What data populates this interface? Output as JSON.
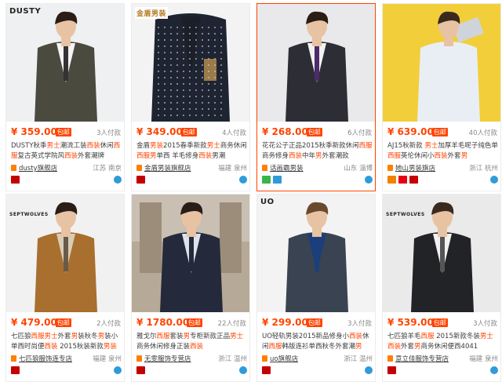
{
  "products": [
    {
      "brand": "DUSTY",
      "brand_style": "text",
      "price": "¥ 359.00",
      "tag": "包邮",
      "buyers": "3人付款",
      "title_parts": [
        "DUSTY秋季",
        "男士",
        "潮流工装",
        "西装",
        "休闲",
        "西服",
        "复古英式学院风",
        "西装",
        "外套潮牌"
      ],
      "title_hl": [
        false,
        true,
        false,
        true,
        false,
        true,
        false,
        true,
        false
      ],
      "shop": "dusty旗舰店",
      "location": "江苏 南京",
      "badges": [
        "tmall-icon"
      ],
      "colors": {
        "bg": "#eef0f2",
        "coat": "#4a4a3f",
        "shirt": "#f4f4f4",
        "pants": "#2b2b2b",
        "tie": "#333333",
        "skin": "#e7c3a3",
        "hair": "#2a1d17"
      }
    },
    {
      "brand": "金盾男装",
      "brand_style": "logo",
      "price": "¥ 349.00",
      "tag": "包邮",
      "buyers": "4人付款",
      "title_parts": [
        "金盾",
        "男装",
        "2015春季新款",
        "男士",
        "商务休闲",
        "西服",
        "男",
        "单西 羊毛修身",
        "西装",
        "男潮"
      ],
      "title_hl": [
        false,
        true,
        false,
        true,
        false,
        true,
        true,
        false,
        true,
        false
      ],
      "shop": "金盾男装旗舰店",
      "location": "福建 泉州",
      "badges": [
        "tmall-icon"
      ],
      "colors": {
        "bg": "#f3f3f3",
        "coat": "#1e2431",
        "shirt": "#1b1f28",
        "pants": "#1e2431",
        "tie": "#1e2431",
        "skin": "#ffffff",
        "hair": "#ffffff"
      }
    },
    {
      "brand": "",
      "brand_style": "none",
      "price": "¥ 268.00",
      "tag": "包邮",
      "buyers": "6人付款",
      "title_parts": [
        "花花公子正品2015秋季新款休闲",
        "西服",
        " 商务修身",
        "西装",
        "中年",
        "男",
        "外套潮款"
      ],
      "title_hl": [
        false,
        true,
        false,
        true,
        false,
        true,
        false
      ],
      "shop": "话画霸男装",
      "location": "山东 淄博",
      "badges": [
        "green-badge",
        "blue-badge"
      ],
      "colors": {
        "bg": "#e9e9eb",
        "coat": "#2c2d35",
        "shirt": "#f1f1f1",
        "pants": "#2c2d35",
        "tie": "#4d2a6a",
        "skin": "#e7c3a3",
        "hair": "#2a1d17"
      }
    },
    {
      "brand": "",
      "brand_style": "none",
      "price": "¥ 639.00",
      "tag": "包邮",
      "buyers": "40人付款",
      "title_parts": [
        "AJ15秋新款 ",
        "男士",
        "加厚羊毛呢子纯色单",
        "西服",
        "英伦休闲小",
        "西装",
        "外套",
        "男"
      ],
      "title_hl": [
        false,
        true,
        false,
        true,
        false,
        true,
        false,
        true
      ],
      "shop": "她山男装旗店",
      "location": "浙江 杭州",
      "badges": [
        "multi-badge",
        "tmall-icon"
      ],
      "colors": {
        "bg": "#f2ce3a",
        "coat": "#e9eef5",
        "shirt": "#e9eef5",
        "pants": "#2a2a2a",
        "tie": "#e9eef5",
        "skin": "#e7c3a3",
        "hair": "#3a2a1e"
      }
    },
    {
      "brand": "SEPTWOLVES",
      "brand_style": "wolf",
      "price": "¥ 479.00",
      "tag": "包邮",
      "buyers": "2人付款",
      "title_parts": [
        "七匹狼",
        "西服",
        "男士",
        "外套",
        "男",
        "装秋冬",
        "男",
        "装小单西时尚便",
        "西装",
        " 2015秋装新款",
        "男装"
      ],
      "title_hl": [
        false,
        true,
        true,
        false,
        true,
        false,
        true,
        false,
        true,
        false,
        true
      ],
      "shop": "七匹狼服饰连专店",
      "location": "福建 泉州",
      "badges": [
        "tmall-icon"
      ],
      "colors": {
        "bg": "#f1f1f1",
        "coat": "#a86f2f",
        "shirt": "#d9cdb5",
        "pants": "#2b2b2b",
        "tie": "#6a5a48",
        "skin": "#e7c3a3",
        "hair": "#2a1d17"
      }
    },
    {
      "brand": "",
      "brand_style": "none",
      "price": "¥ 1780.00",
      "tag": "包邮",
      "buyers": "22人付款",
      "title_parts": [
        "雅戈尔",
        "西服",
        "套装",
        "男",
        "专柜新款正品",
        "男士",
        "商务休闲修身正装",
        "西装"
      ],
      "title_hl": [
        false,
        true,
        false,
        true,
        false,
        true,
        false,
        true
      ],
      "shop": "无雯服饰专营店",
      "location": "浙江 温州",
      "badges": [
        "tmall-icon"
      ],
      "colors": {
        "bg": "#b7a998",
        "coat": "#242a3b",
        "shirt": "#dde3ec",
        "pants": "#242a3b",
        "tie": "#242a3b",
        "skin": "#e7c3a3",
        "hair": "#2a1d17"
      }
    },
    {
      "brand": "UO",
      "brand_style": "uo",
      "price": "¥ 299.00",
      "tag": "包邮",
      "buyers": "3人付款",
      "title_parts": [
        "UO轻轨男装2015新品修身小",
        "西装",
        "休闲",
        "西服",
        "韩版连衫单西秋冬外套潮",
        "男"
      ],
      "title_hl": [
        false,
        true,
        false,
        true,
        false,
        true
      ],
      "shop": "uo旗舰店",
      "location": "浙江 温州",
      "badges": [
        "tmall-icon"
      ],
      "colors": {
        "bg": "#f3f3f3",
        "coat": "#3a4352",
        "shirt": "#1b3f7a",
        "pants": "#2b2b2b",
        "tie": "#1b3f7a",
        "skin": "#e7c3a3",
        "hair": "#6a4a2e"
      }
    },
    {
      "brand": "SEPTWOLVES",
      "brand_style": "wolf",
      "price": "¥ 539.00",
      "tag": "包邮",
      "buyers": "3人付款",
      "title_parts": [
        "七匹狼羊毛",
        "西服",
        " 2015新款冬装",
        "男士",
        "西装",
        "外套",
        "男",
        "商务休闲便西4041"
      ],
      "title_hl": [
        false,
        true,
        false,
        true,
        true,
        false,
        true,
        false
      ],
      "shop": "意立佳服饰专营店",
      "location": "福建 泉州",
      "badges": [
        "tmall-icon"
      ],
      "colors": {
        "bg": "#eaeaea",
        "coat": "#222326",
        "shirt": "#f1f1f1",
        "pants": "#222326",
        "tie": "#555555",
        "skin": "#e7c3a3",
        "hair": "#3a2a1e"
      }
    }
  ]
}
